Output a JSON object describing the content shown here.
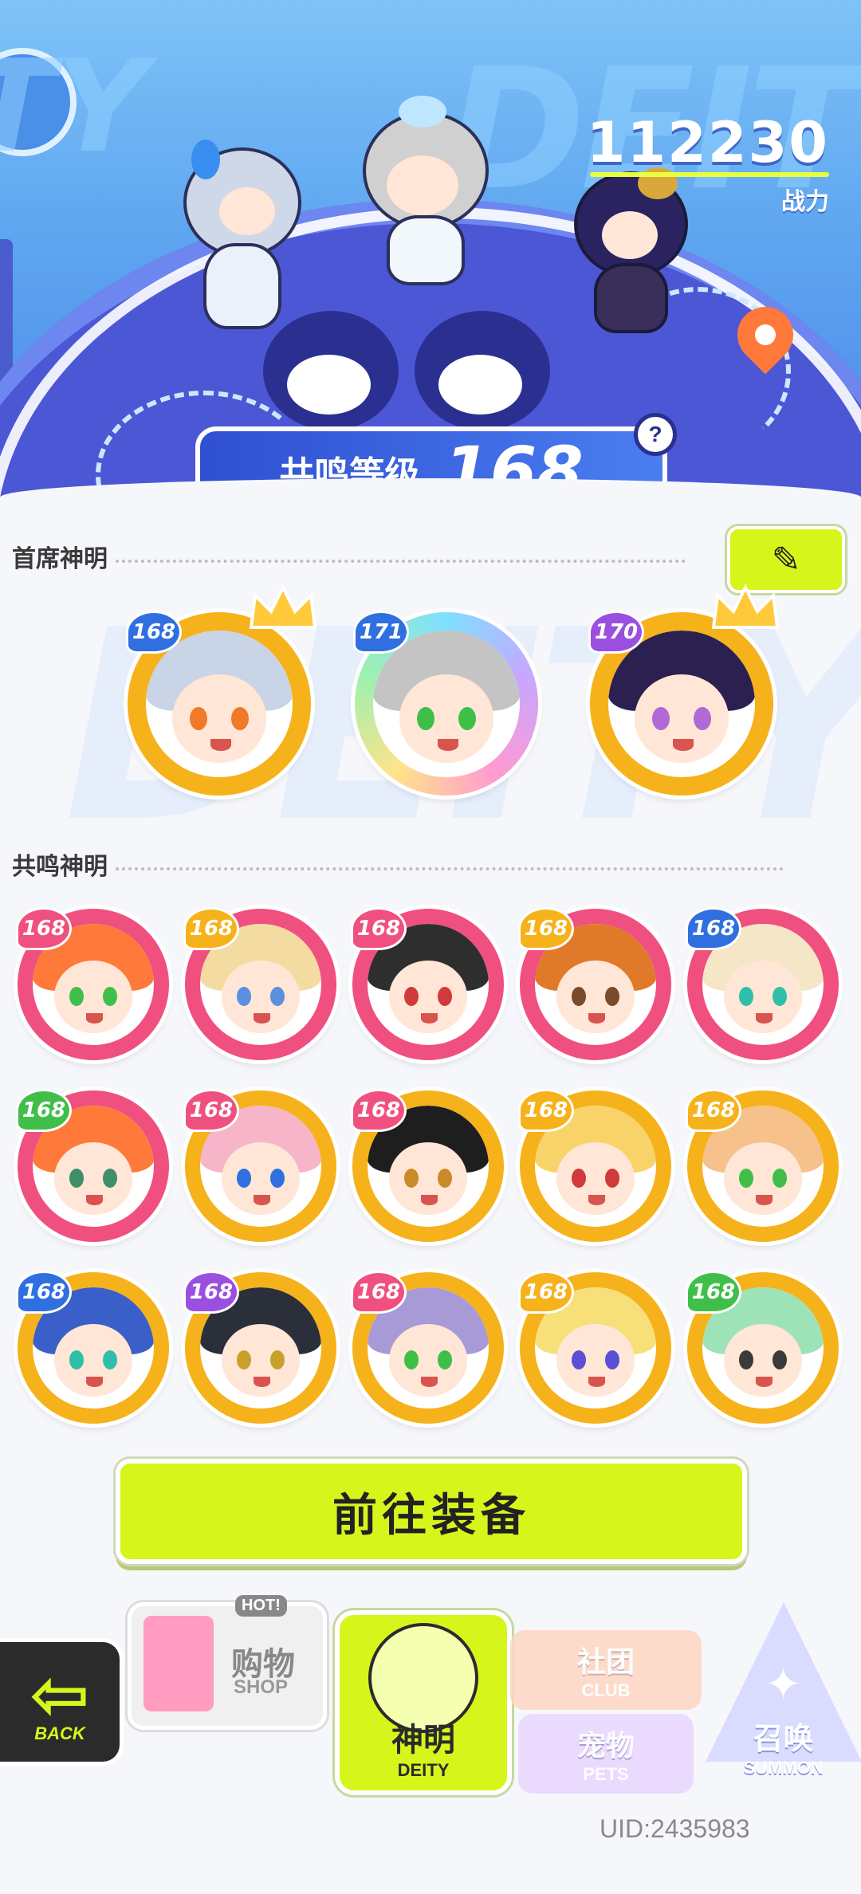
{
  "hero": {
    "bg_word": "DEITY",
    "power": {
      "value": "112230",
      "label": "战力"
    },
    "resonance": {
      "label": "共鸣等级",
      "level": "168",
      "help": "?"
    }
  },
  "primary": {
    "title": "首席神明",
    "edit_icon": "pencil-icon",
    "avatars": [
      {
        "level": "168",
        "ring": "#f6b21b",
        "badge": "#2f6fe0",
        "hair": "#c9d4e6",
        "eye": "#f07a2a",
        "crown": true
      },
      {
        "level": "171",
        "ring": "rainbow",
        "badge": "#2f6fe0",
        "hair": "#c4c4c4",
        "eye": "#3fbf4a",
        "crown": false
      },
      {
        "level": "170",
        "ring": "#f6b21b",
        "badge": "#9b4fe0",
        "hair": "#2b2050",
        "eye": "#b06ad6",
        "crown": true
      }
    ]
  },
  "resonance_section": {
    "title": "共鸣神明",
    "rows": [
      [
        {
          "level": "168",
          "ring": "#f0507f",
          "badge": "#f0507f",
          "hair": "#ff7a3a",
          "eye": "#3fbf4a"
        },
        {
          "level": "168",
          "ring": "#f0507f",
          "badge": "#f6b21b",
          "hair": "#f3dba2",
          "eye": "#5b8fe0"
        },
        {
          "level": "168",
          "ring": "#f0507f",
          "badge": "#f0507f",
          "hair": "#2e2e2e",
          "eye": "#d03a3a"
        },
        {
          "level": "168",
          "ring": "#f0507f",
          "badge": "#f6b21b",
          "hair": "#e07a2a",
          "eye": "#7a4a2a"
        },
        {
          "level": "168",
          "ring": "#f0507f",
          "badge": "#2f6fe0",
          "hair": "#f5e6c8",
          "eye": "#2fbfa8"
        }
      ],
      [
        {
          "level": "168",
          "ring": "#f0507f",
          "badge": "#3fbf4a",
          "hair": "#ff7a3a",
          "eye": "#3f8f6a"
        },
        {
          "level": "168",
          "ring": "#f6b21b",
          "badge": "#f0507f",
          "hair": "#f7b5c9",
          "eye": "#2f6fe0"
        },
        {
          "level": "168",
          "ring": "#f6b21b",
          "badge": "#f0507f",
          "hair": "#1e1e1e",
          "eye": "#c98a2a"
        },
        {
          "level": "168",
          "ring": "#f6b21b",
          "badge": "#f6b21b",
          "hair": "#f7d36a",
          "eye": "#d03a3a"
        },
        {
          "level": "168",
          "ring": "#f6b21b",
          "badge": "#f6b21b",
          "hair": "#f6c18a",
          "eye": "#3fbf4a"
        }
      ],
      [
        {
          "level": "168",
          "ring": "#f6b21b",
          "badge": "#2f6fe0",
          "hair": "#3a5fc9",
          "eye": "#2fbfa8"
        },
        {
          "level": "168",
          "ring": "#f6b21b",
          "badge": "#9b4fe0",
          "hair": "#2a2f3a",
          "eye": "#c9a02a"
        },
        {
          "level": "168",
          "ring": "#f6b21b",
          "badge": "#f0507f",
          "hair": "#a89ad6",
          "eye": "#3fbf4a"
        },
        {
          "level": "168",
          "ring": "#f6b21b",
          "badge": "#f6b21b",
          "hair": "#f7e07a",
          "eye": "#5b4fd6"
        },
        {
          "level": "168",
          "ring": "#f6b21b",
          "badge": "#3fbf4a",
          "hair": "#9ee3b8",
          "eye": "#3a3a3a"
        }
      ]
    ]
  },
  "go_button": "前往装备",
  "nav": {
    "back": {
      "text": "BACK",
      "icon": "back-arrow-icon"
    },
    "shop": {
      "label": "购物",
      "sub": "SHOP",
      "tag": "HOT!",
      "icon": "vending-machine-icon"
    },
    "deity": {
      "label": "神明",
      "sub": "DEITY",
      "icon": "deity-character-icon"
    },
    "club": {
      "label": "社团",
      "sub": "CLUB",
      "icon": "bag-icon"
    },
    "pets": {
      "label": "宠物",
      "sub": "PETS",
      "icon": "pet-icon"
    },
    "summon": {
      "label": "召唤",
      "sub": "SUMMON",
      "icon": "star-icon"
    }
  },
  "uid": "UID:2435983"
}
